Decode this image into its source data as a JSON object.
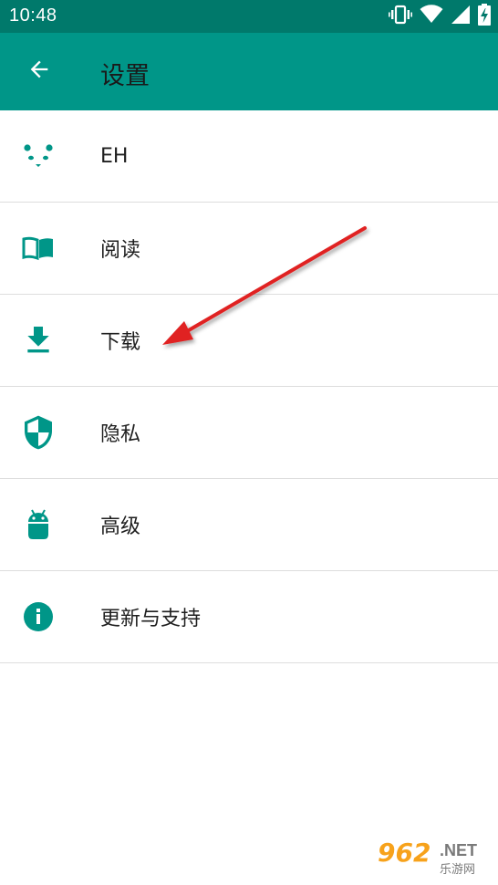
{
  "status_bar": {
    "time": "10:48",
    "icons": [
      "vibrate-icon",
      "wifi-icon",
      "signal-icon",
      "battery-charging-icon"
    ]
  },
  "app_bar": {
    "title": "设置",
    "back_icon": "arrow-back-icon",
    "color": "#009688"
  },
  "settings": {
    "items": [
      {
        "label": "EH",
        "icon": "panda-icon"
      },
      {
        "label": "阅读",
        "icon": "book-icon"
      },
      {
        "label": "下载",
        "icon": "download-icon"
      },
      {
        "label": "隐私",
        "icon": "shield-icon"
      },
      {
        "label": "高级",
        "icon": "android-icon"
      },
      {
        "label": "更新与支持",
        "icon": "info-icon"
      }
    ],
    "icon_color": "#009688"
  },
  "watermark": {
    "number": "962",
    "suffix": ".NET",
    "subtitle": "乐游网"
  },
  "annotation": {
    "arrow_color": "#e02020",
    "points_to": "下载"
  }
}
